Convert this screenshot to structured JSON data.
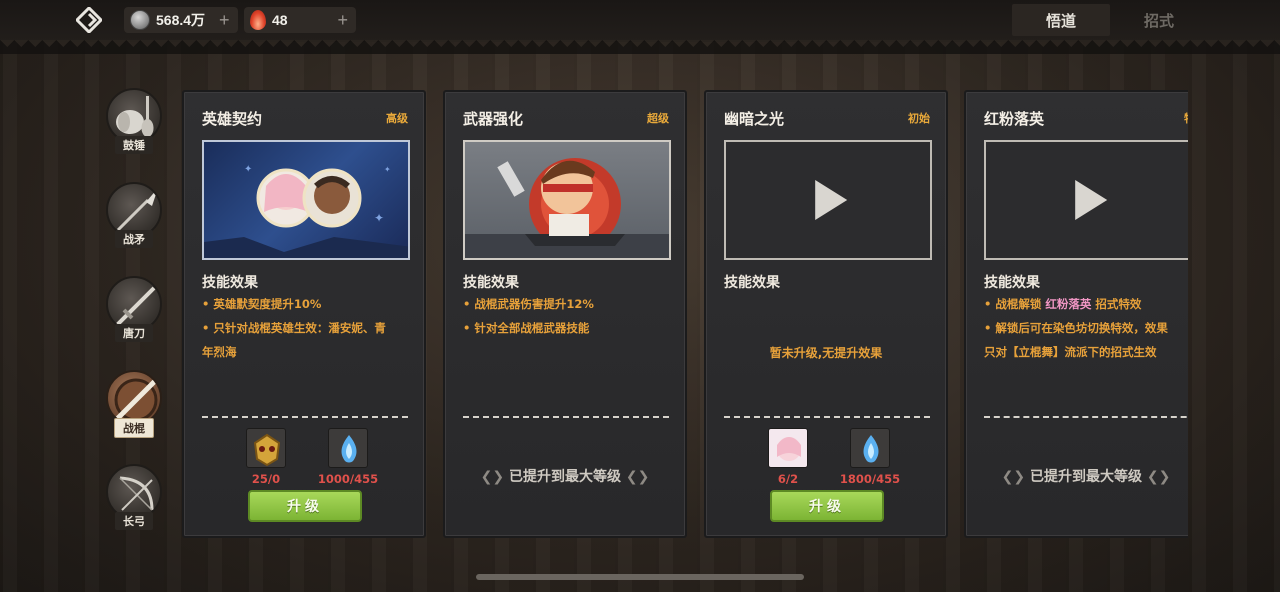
{
  "resources": {
    "silver": "568.4万",
    "spirit": "48"
  },
  "tabs": [
    "悟道",
    "招式"
  ],
  "nav": [
    {
      "label": "鼓锤"
    },
    {
      "label": "战矛"
    },
    {
      "label": "唐刀"
    },
    {
      "label": "战棍"
    },
    {
      "label": "长弓"
    }
  ],
  "cards": [
    {
      "title": "英雄契约",
      "tier": "高级",
      "section": "技能效果",
      "effects": [
        "• 英雄默契度提升10%",
        "• 只针对战棍英雄生效：潘安妮、青",
        "年烈海"
      ],
      "mats": [
        "25/0",
        "1000/455"
      ],
      "button": "升级"
    },
    {
      "title": "武器强化",
      "tier": "超级",
      "section": "技能效果",
      "effects": [
        "• 战棍武器伤害提升12%",
        "• 针对全部战棍武器技能"
      ],
      "maxed": "已提升到最大等级"
    },
    {
      "title": "幽暗之光",
      "tier": "初始",
      "section": "技能效果",
      "no_effect": "暂未升级,无提升效果",
      "mats": [
        "6/2",
        "1800/455"
      ],
      "button": "升级"
    },
    {
      "title": "红粉落英",
      "tier": "特效",
      "section": "技能效果",
      "effect1_a": "• 战棍解锁 ",
      "effect1_hl": "红粉落英",
      "effect1_b": " 招式特效",
      "effects": [
        "• 解锁后可在染色坊切换特效，效果",
        "只对【立棍舞】流派下的招式生效"
      ],
      "maxed": "已提升到最大等级"
    }
  ],
  "colors": {
    "tier": "#e9a93a",
    "effect": "#e7a13a",
    "highlight": "#f096c4",
    "mat_count": "#e0514b",
    "button": "#8cc63f"
  }
}
